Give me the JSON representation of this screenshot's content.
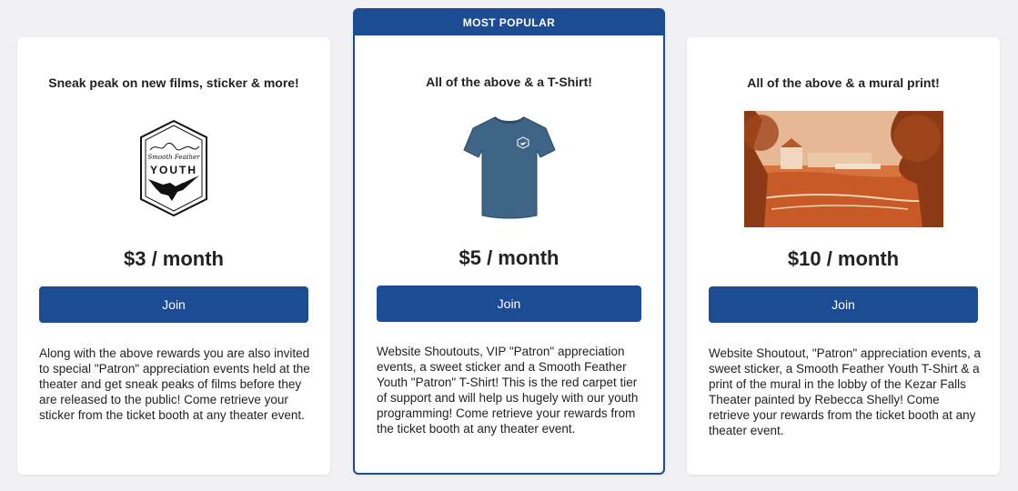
{
  "tiers": [
    {
      "title": "Sneak peak on new films, sticker & more!",
      "logo_script": "Smooth Feather",
      "logo_word": "YOUTH",
      "price": "$3 / month",
      "join_label": "Join",
      "description": "Along with the above rewards you are also invited to special \"Patron\" appreciation events held at the theater and get sneak peaks of films before they are released to the public!  Come retrieve your sticker from the ticket booth at any theater event."
    },
    {
      "badge": "MOST POPULAR",
      "title": "All of the above & a T-Shirt!",
      "price": "$5 / month",
      "join_label": "Join",
      "description": "Website Shoutouts, VIP \"Patron\" appreciation events, a sweet sticker and a Smooth Feather Youth \"Patron\" T-Shirt! This is the red carpet tier of support and will help us hugely with our youth programming! Come retrieve your rewards from the ticket booth at any theater event."
    },
    {
      "title": "All of the above & a mural print!",
      "price": "$10 / month",
      "join_label": "Join",
      "description": "Website Shoutout, \"Patron\" appreciation events, a sweet sticker, a Smooth Feather Youth T-Shirt & a print of the mural in the lobby of the Kezar Falls Theater painted by Rebecca Shelly! Come retrieve your rewards from the ticket booth at any theater event."
    }
  ],
  "colors": {
    "accent": "#1c4c93",
    "background": "#f1f1f3",
    "card": "#ffffff",
    "shirt": "#3e6586",
    "mural": "#d56a38"
  },
  "icons": [
    "smooth-feather-youth-logo",
    "t-shirt-image",
    "mural-print-image"
  ]
}
